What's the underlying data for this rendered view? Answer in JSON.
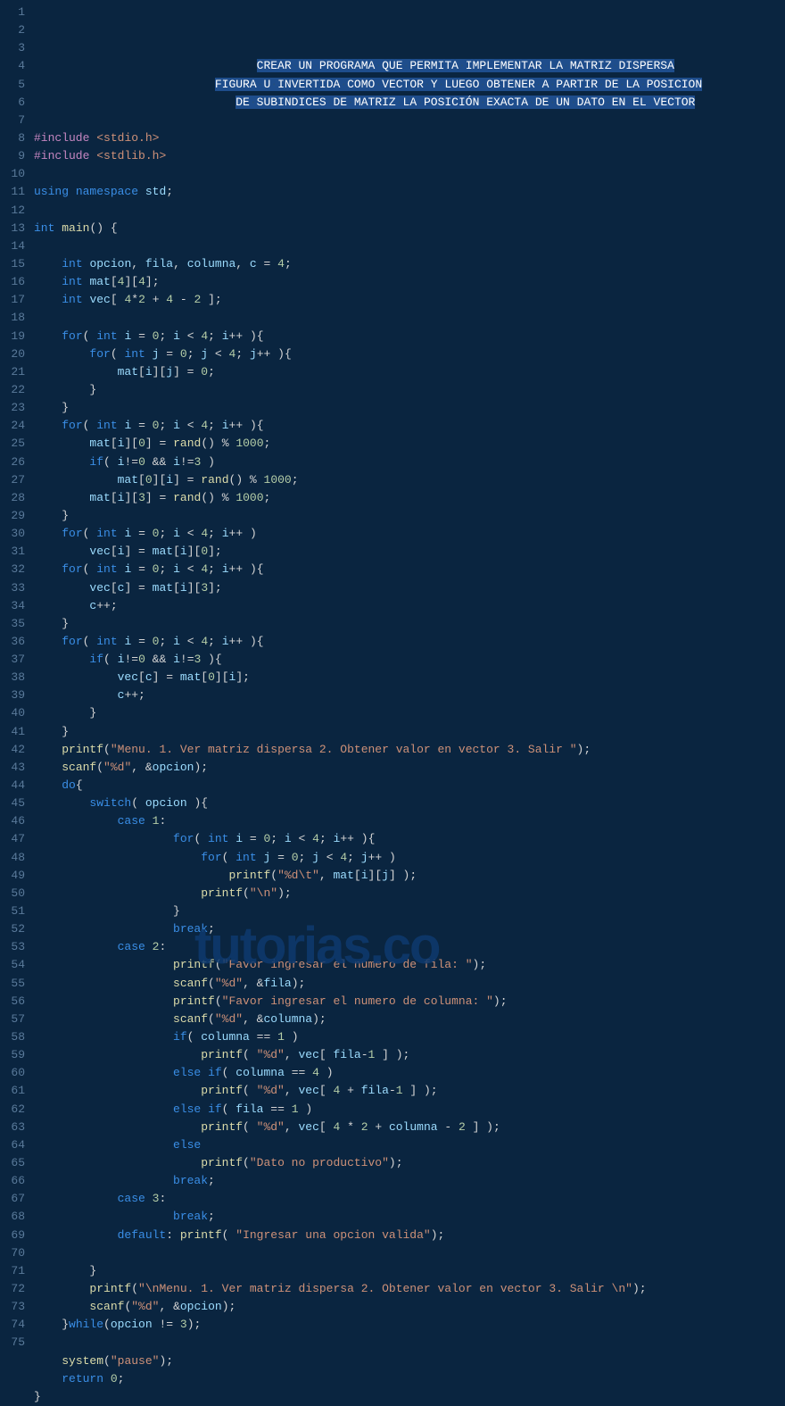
{
  "watermark": "tutorias.co",
  "header_comment": [
    "CREAR UN PROGRAMA QUE PERMITA IMPLEMENTAR LA MATRIZ DISPERSA",
    "FIGURA U INVERTIDA COMO VECTOR Y LUEGO OBTENER A PARTIR DE LA POSICION",
    "DE SUBINDICES DE MATRIZ LA POSICIÓN EXACTA DE UN DATO EN EL VECTOR"
  ],
  "lines": [
    {
      "n": 1,
      "html": "                                <span class='hl-sel'>CREAR<span class='ws-dot'>·</span>UN<span class='ws-dot'>·</span>PROGRAMA<span class='ws-dot'>·</span>QUE<span class='ws-dot'>·</span>PERMITA<span class='ws-dot'>·</span>IMPLEMENTAR<span class='ws-dot'>·</span>LA<span class='ws-dot'>·</span>MATRIZ<span class='ws-dot'>·</span>DISPERSA</span>"
    },
    {
      "n": 2,
      "html": "                          <span class='hl-sel'>FIGURA<span class='ws-dot'>·</span>U<span class='ws-dot'>·</span>INVERTIDA<span class='ws-dot'>·</span>COMO<span class='ws-dot'>·</span>VECTOR<span class='ws-dot'>·</span>Y<span class='ws-dot'>·</span>LUEGO<span class='ws-dot'>·</span>OBTENER<span class='ws-dot'>·</span>A<span class='ws-dot'>·</span>PARTIR<span class='ws-dot'>·</span>DE<span class='ws-dot'>·</span>LA<span class='ws-dot'>·</span>POSICION</span>"
    },
    {
      "n": 3,
      "html": "                             <span class='hl-sel'>DE<span class='ws-dot'>·</span>SUBINDICES<span class='ws-dot'>·</span>DE<span class='ws-dot'>·</span>MATRIZ<span class='ws-dot'>·</span>LA<span class='ws-dot'>·</span>POSICIÓN<span class='ws-dot'>·</span>EXACTA<span class='ws-dot'>·</span>DE<span class='ws-dot'>·</span>UN<span class='ws-dot'>·</span>DATO<span class='ws-dot'>·</span>EN<span class='ws-dot'>·</span>EL<span class='ws-dot'>·</span>VECTOR</span>"
    },
    {
      "n": 4,
      "html": ""
    },
    {
      "n": 5,
      "html": "<span class='pp'>#include</span> <span class='inc'>&lt;stdio.h&gt;</span>"
    },
    {
      "n": 6,
      "html": "<span class='pp'>#include</span> <span class='inc'>&lt;stdlib.h&gt;</span>"
    },
    {
      "n": 7,
      "html": ""
    },
    {
      "n": 8,
      "html": "<span class='k'>using</span> <span class='k'>namespace</span> <span class='v'>std</span>;"
    },
    {
      "n": 9,
      "html": ""
    },
    {
      "n": 10,
      "html": "<span class='t'>int</span> <span class='f'>main</span>() {"
    },
    {
      "n": 11,
      "html": ""
    },
    {
      "n": 12,
      "html": "    <span class='t'>int</span> <span class='v'>opcion</span>, <span class='v'>fila</span>, <span class='v'>columna</span>, <span class='v'>c</span> = <span class='n'>4</span>;"
    },
    {
      "n": 13,
      "html": "    <span class='t'>int</span> <span class='v'>mat</span>[<span class='n'>4</span>][<span class='n'>4</span>];"
    },
    {
      "n": 14,
      "html": "    <span class='t'>int</span> <span class='v'>vec</span>[ <span class='n'>4</span>*<span class='n'>2</span> + <span class='n'>4</span> - <span class='n'>2</span> ];"
    },
    {
      "n": 15,
      "html": ""
    },
    {
      "n": 16,
      "html": "    <span class='k'>for</span>( <span class='t'>int</span> <span class='v'>i</span> = <span class='n'>0</span>; <span class='v'>i</span> &lt; <span class='n'>4</span>; <span class='v'>i</span>++ ){"
    },
    {
      "n": 17,
      "html": "        <span class='k'>for</span>( <span class='t'>int</span> <span class='v'>j</span> = <span class='n'>0</span>; <span class='v'>j</span> &lt; <span class='n'>4</span>; <span class='v'>j</span>++ ){"
    },
    {
      "n": 18,
      "html": "            <span class='v'>mat</span>[<span class='v'>i</span>][<span class='v'>j</span>] = <span class='n'>0</span>;"
    },
    {
      "n": 19,
      "html": "        }"
    },
    {
      "n": 20,
      "html": "    }"
    },
    {
      "n": 21,
      "html": "    <span class='k'>for</span>( <span class='t'>int</span> <span class='v'>i</span> = <span class='n'>0</span>; <span class='v'>i</span> &lt; <span class='n'>4</span>; <span class='v'>i</span>++ ){"
    },
    {
      "n": 22,
      "html": "        <span class='v'>mat</span>[<span class='v'>i</span>][<span class='n'>0</span>] = <span class='f'>rand</span>() % <span class='n'>1000</span>;"
    },
    {
      "n": 23,
      "html": "        <span class='k'>if</span>( <span class='v'>i</span>!=<span class='n'>0</span> &amp;&amp; <span class='v'>i</span>!=<span class='n'>3</span> )"
    },
    {
      "n": 24,
      "html": "            <span class='v'>mat</span>[<span class='n'>0</span>][<span class='v'>i</span>] = <span class='f'>rand</span>() % <span class='n'>1000</span>;"
    },
    {
      "n": 25,
      "html": "        <span class='v'>mat</span>[<span class='v'>i</span>][<span class='n'>3</span>] = <span class='f'>rand</span>() % <span class='n'>1000</span>;"
    },
    {
      "n": 26,
      "html": "    }"
    },
    {
      "n": 27,
      "html": "    <span class='k'>for</span>( <span class='t'>int</span> <span class='v'>i</span> = <span class='n'>0</span>; <span class='v'>i</span> &lt; <span class='n'>4</span>; <span class='v'>i</span>++ )"
    },
    {
      "n": 28,
      "html": "        <span class='v'>vec</span>[<span class='v'>i</span>] = <span class='v'>mat</span>[<span class='v'>i</span>][<span class='n'>0</span>];"
    },
    {
      "n": 29,
      "html": "    <span class='k'>for</span>( <span class='t'>int</span> <span class='v'>i</span> = <span class='n'>0</span>; <span class='v'>i</span> &lt; <span class='n'>4</span>; <span class='v'>i</span>++ ){"
    },
    {
      "n": 30,
      "html": "        <span class='v'>vec</span>[<span class='v'>c</span>] = <span class='v'>mat</span>[<span class='v'>i</span>][<span class='n'>3</span>];"
    },
    {
      "n": 31,
      "html": "        <span class='v'>c</span>++;"
    },
    {
      "n": 32,
      "html": "    }"
    },
    {
      "n": 33,
      "html": "    <span class='k'>for</span>( <span class='t'>int</span> <span class='v'>i</span> = <span class='n'>0</span>; <span class='v'>i</span> &lt; <span class='n'>4</span>; <span class='v'>i</span>++ ){"
    },
    {
      "n": 34,
      "html": "        <span class='k'>if</span>( <span class='v'>i</span>!=<span class='n'>0</span> &amp;&amp; <span class='v'>i</span>!=<span class='n'>3</span> ){"
    },
    {
      "n": 35,
      "html": "            <span class='v'>vec</span>[<span class='v'>c</span>] = <span class='v'>mat</span>[<span class='n'>0</span>][<span class='v'>i</span>];"
    },
    {
      "n": 36,
      "html": "            <span class='v'>c</span>++;"
    },
    {
      "n": 37,
      "html": "        }"
    },
    {
      "n": 38,
      "html": "    }"
    },
    {
      "n": 39,
      "html": "    <span class='f'>printf</span>(<span class='s'>\"Menu. 1. Ver matriz dispersa 2. Obtener valor en vector 3. Salir \"</span>);"
    },
    {
      "n": 40,
      "html": "    <span class='f'>scanf</span>(<span class='s'>\"%d\"</span>, &amp;<span class='v'>opcion</span>);"
    },
    {
      "n": 41,
      "html": "    <span class='k'>do</span>{"
    },
    {
      "n": 42,
      "html": "        <span class='k'>switch</span>( <span class='v'>opcion</span> ){"
    },
    {
      "n": 43,
      "html": "            <span class='k'>case</span> <span class='n'>1</span>:"
    },
    {
      "n": 44,
      "html": "                    <span class='k'>for</span>( <span class='t'>int</span> <span class='v'>i</span> = <span class='n'>0</span>; <span class='v'>i</span> &lt; <span class='n'>4</span>; <span class='v'>i</span>++ ){"
    },
    {
      "n": 45,
      "html": "                        <span class='k'>for</span>( <span class='t'>int</span> <span class='v'>j</span> = <span class='n'>0</span>; <span class='v'>j</span> &lt; <span class='n'>4</span>; <span class='v'>j</span>++ )"
    },
    {
      "n": 46,
      "html": "                            <span class='f'>printf</span>(<span class='s'>\"%d\\t\"</span>, <span class='v'>mat</span>[<span class='v'>i</span>][<span class='v'>j</span>] );"
    },
    {
      "n": 47,
      "html": "                        <span class='f'>printf</span>(<span class='s'>\"\\n\"</span>);"
    },
    {
      "n": 48,
      "html": "                    }"
    },
    {
      "n": 49,
      "html": "                    <span class='k'>break</span>;"
    },
    {
      "n": 50,
      "html": "            <span class='k'>case</span> <span class='n'>2</span>:"
    },
    {
      "n": 51,
      "html": "                    <span class='f'>printf</span>(<span class='s'>\"Favor ingresar el numero de fila: \"</span>);"
    },
    {
      "n": 52,
      "html": "                    <span class='f'>scanf</span>(<span class='s'>\"%d\"</span>, &amp;<span class='v'>fila</span>);"
    },
    {
      "n": 53,
      "html": "                    <span class='f'>printf</span>(<span class='s'>\"Favor ingresar el numero de columna: \"</span>);"
    },
    {
      "n": 54,
      "html": "                    <span class='f'>scanf</span>(<span class='s'>\"%d\"</span>, &amp;<span class='v'>columna</span>);"
    },
    {
      "n": 55,
      "html": "                    <span class='k'>if</span>( <span class='v'>columna</span> == <span class='n'>1</span> )"
    },
    {
      "n": 56,
      "html": "                        <span class='f'>printf</span>( <span class='s'>\"%d\"</span>, <span class='v'>vec</span>[ <span class='v'>fila</span>-<span class='n'>1</span> ] );"
    },
    {
      "n": 57,
      "html": "                    <span class='k'>else</span> <span class='k'>if</span>( <span class='v'>columna</span> == <span class='n'>4</span> )"
    },
    {
      "n": 58,
      "html": "                        <span class='f'>printf</span>( <span class='s'>\"%d\"</span>, <span class='v'>vec</span>[ <span class='n'>4</span> + <span class='v'>fila</span>-<span class='n'>1</span> ] );"
    },
    {
      "n": 59,
      "html": "                    <span class='k'>else</span> <span class='k'>if</span>( <span class='v'>fila</span> == <span class='n'>1</span> )"
    },
    {
      "n": 60,
      "html": "                        <span class='f'>printf</span>( <span class='s'>\"%d\"</span>, <span class='v'>vec</span>[ <span class='n'>4</span> * <span class='n'>2</span> + <span class='v'>columna</span> - <span class='n'>2</span> ] );"
    },
    {
      "n": 61,
      "html": "                    <span class='k'>else</span>"
    },
    {
      "n": 62,
      "html": "                        <span class='f'>printf</span>(<span class='s'>\"Dato no productivo\"</span>);"
    },
    {
      "n": 63,
      "html": "                    <span class='k'>break</span>;"
    },
    {
      "n": 64,
      "html": "            <span class='k'>case</span> <span class='n'>3</span>:"
    },
    {
      "n": 65,
      "html": "                    <span class='k'>break</span>;"
    },
    {
      "n": 66,
      "html": "            <span class='k'>default</span>: <span class='f'>printf</span>( <span class='s'>\"Ingresar una opcion valida\"</span>);"
    },
    {
      "n": 67,
      "html": ""
    },
    {
      "n": 68,
      "html": "        }"
    },
    {
      "n": 69,
      "html": "        <span class='f'>printf</span>(<span class='s'>\"\\nMenu. 1. Ver matriz dispersa 2. Obtener valor en vector 3. Salir \\n\"</span>);"
    },
    {
      "n": 70,
      "html": "        <span class='f'>scanf</span>(<span class='s'>\"%d\"</span>, &amp;<span class='v'>opcion</span>);"
    },
    {
      "n": 71,
      "html": "    }<span class='k'>while</span>(<span class='v'>opcion</span> != <span class='n'>3</span>);"
    },
    {
      "n": 72,
      "html": ""
    },
    {
      "n": 73,
      "html": "    <span class='f'>system</span>(<span class='s'>\"pause\"</span>);"
    },
    {
      "n": 74,
      "html": "    <span class='k'>return</span> <span class='n'>0</span>;"
    },
    {
      "n": 75,
      "html": "}"
    }
  ],
  "source_code_plain": "#include <stdio.h>\n#include <stdlib.h>\n\nusing namespace std;\n\nint main() {\n\n    int opcion, fila, columna, c = 4;\n    int mat[4][4];\n    int vec[ 4*2 + 4 - 2 ];\n\n    for( int i = 0; i < 4; i++ ){\n        for( int j = 0; j < 4; j++ ){\n            mat[i][j] = 0;\n        }\n    }\n    for( int i = 0; i < 4; i++ ){\n        mat[i][0] = rand() % 1000;\n        if( i!=0 && i!=3 )\n            mat[0][i] = rand() % 1000;\n        mat[i][3] = rand() % 1000;\n    }\n    for( int i = 0; i < 4; i++ )\n        vec[i] = mat[i][0];\n    for( int i = 0; i < 4; i++ ){\n        vec[c] = mat[i][3];\n        c++;\n    }\n    for( int i = 0; i < 4; i++ ){\n        if( i!=0 && i!=3 ){\n            vec[c] = mat[0][i];\n            c++;\n        }\n    }\n    printf(\"Menu. 1. Ver matriz dispersa 2. Obtener valor en vector 3. Salir \");\n    scanf(\"%d\", &opcion);\n    do{\n        switch( opcion ){\n            case 1:\n                    for( int i = 0; i < 4; i++ ){\n                        for( int j = 0; j < 4; j++ )\n                            printf(\"%d\\t\", mat[i][j] );\n                        printf(\"\\n\");\n                    }\n                    break;\n            case 2:\n                    printf(\"Favor ingresar el numero de fila: \");\n                    scanf(\"%d\", &fila);\n                    printf(\"Favor ingresar el numero de columna: \");\n                    scanf(\"%d\", &columna);\n                    if( columna == 1 )\n                        printf( \"%d\", vec[ fila-1 ] );\n                    else if( columna == 4 )\n                        printf( \"%d\", vec[ 4 + fila-1 ] );\n                    else if( fila == 1 )\n                        printf( \"%d\", vec[ 4 * 2 + columna - 2 ] );\n                    else\n                        printf(\"Dato no productivo\");\n                    break;\n            case 3:\n                    break;\n            default: printf( \"Ingresar una opcion valida\");\n\n        }\n        printf(\"\\nMenu. 1. Ver matriz dispersa 2. Obtener valor en vector 3. Salir \\n\");\n        scanf(\"%d\", &opcion);\n    }while(opcion != 3);\n\n    system(\"pause\");\n    return 0;\n}"
}
